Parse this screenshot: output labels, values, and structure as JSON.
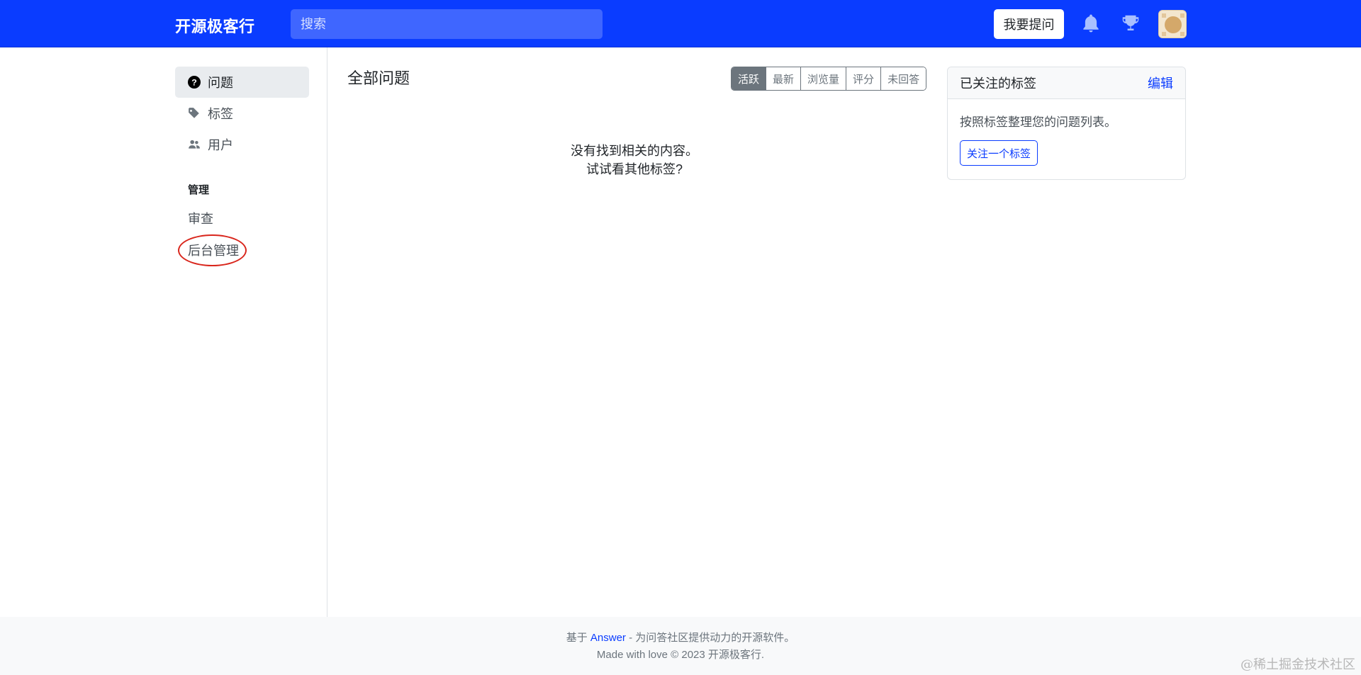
{
  "header": {
    "brand": "开源极客行",
    "search_placeholder": "搜索",
    "ask_button": "我要提问",
    "icons": [
      "bell-icon",
      "trophy-icon"
    ],
    "brand_color": "#0a3cff"
  },
  "sidebar": {
    "items": [
      {
        "label": "问题",
        "icon": "question-circle-icon",
        "active": true
      },
      {
        "label": "标签",
        "icon": "tag-icon",
        "active": false
      },
      {
        "label": "用户",
        "icon": "users-icon",
        "active": false
      }
    ],
    "section_title": "管理",
    "admin_items": [
      {
        "label": "审查"
      },
      {
        "label": "后台管理"
      }
    ]
  },
  "main": {
    "title": "全部问题",
    "sort_tabs": [
      "活跃",
      "最新",
      "浏览量",
      "评分",
      "未回答"
    ],
    "active_sort": "活跃",
    "empty_line1": "没有找到相关的内容。",
    "empty_line2": "试试看其他标签?"
  },
  "followed_tags": {
    "title": "已关注的标签",
    "edit": "编辑",
    "description": "按照标签整理您的问题列表。",
    "follow_button": "关注一个标签"
  },
  "footer": {
    "prefix": "基于 ",
    "link": "Answer",
    "suffix": " - 为问答社区提供动力的开源软件。",
    "line2": "Made with love © 2023 开源极客行."
  },
  "watermark": "@稀土掘金技术社区"
}
